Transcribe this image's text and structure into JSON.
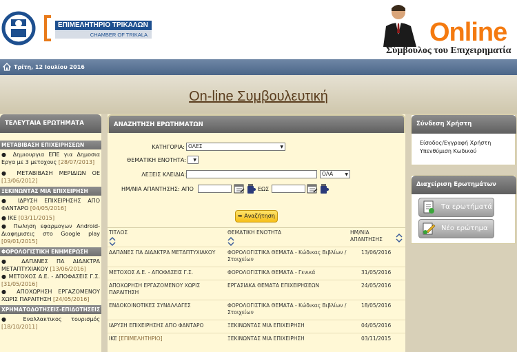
{
  "header": {
    "chamber_gr": "ΕΠΙΜΕΛΗΤΗΡΙΟ ΤΡΙΚΑΛΩΝ",
    "chamber_en": "CHAMBER OF TRIKALA",
    "online": "Online",
    "online_sub": "Σύμβουλος του Επιχειρηματία",
    "accent": "#f47a10"
  },
  "datebar": {
    "date": "Τρίτη, 12 Ιουλίου 2016"
  },
  "banner": {
    "title": "On-line Συμβουλευτική"
  },
  "left": {
    "title": "ΤΕΛΕΥΤΑΙΑ ΕΡΩΤΗΜΑΤΑ",
    "cats": [
      {
        "name": "ΜΕΤΑΒΙΒΑΣΗ ΕΠΙΧΕΙΡΗΣΕΩΝ",
        "items": [
          {
            "text": "Δημιουργια ΕΠΕ για Δημοσια Εργα με 3 μετοχους",
            "date": "[28/07/2013]"
          },
          {
            "text": "ΜΕΤΑΒΙΒΑΣΗ ΜΕΡΙΔΙΩΝ ΟΕ",
            "date": "[13/06/2012]"
          }
        ]
      },
      {
        "name": "ΞΕΚΙΝΩΝΤΑΣ ΜΙΑ ΕΠΙΧΕΙΡΗΣΗ",
        "items": [
          {
            "text": "ΙΔΡΥΣΗ ΕΠΙΧΕΙΡΗΣΗΣ ΑΠΟ ΦΑΝΤΑΡΟ",
            "date": "[04/05/2016]"
          },
          {
            "text": "ΙΚΕ",
            "date": "[03/11/2015]"
          },
          {
            "text": "Πωληση εφαρμογων Android- Διαφημισεις στο Google play",
            "date": "[09/01/2015]"
          }
        ]
      },
      {
        "name": "ΦΟΡΟΛΟΓΙΣΤΙΚΗ ΕΝΗΜΕΡΩΣΗ",
        "items": [
          {
            "text": "ΔΑΠΑΝΕΣ ΠΑ ΔΙΔΑΚΤΡΑ ΜΕΤΑΠΤΥΧΙΑΚΟΥ",
            "date": "[13/06/2016]"
          },
          {
            "text": "ΜΕΤΟΧΟΣ Α.Ε. - ΑΠΟΦΑΣΕΙΣ Γ.Σ.",
            "date": "[31/05/2016]"
          },
          {
            "text": "ΑΠΟΧΩΡΗΣΗ ΕΡΓΑΖΟΜΕΝΟΥ ΧΩΡΙΣ ΠΑΡΑΙΤΗΣΗ",
            "date": "[24/05/2016]"
          }
        ]
      },
      {
        "name": "ΧΡΗΜΑΤΟΔΟΤΗΣΕΙΣ-ΕΠΙΔΟΤΗΣΕΙΣ",
        "items": [
          {
            "text": "Εναλλακτικος τουρισμός",
            "date": "[18/10/2011]"
          }
        ]
      }
    ]
  },
  "search": {
    "title": "ΑΝΑΖΗΤΗΣΗ ΕΡΩΤΗΜΑΤΩΝ",
    "category_label": "ΚΑΤΗΓΟΡΙΑ:",
    "category_value": "ΟΛΕΣ",
    "theme_label": "ΘΕΜΑΤΙΚΗ ΕΝΟΤΗΤΑ:",
    "keywords_label": "ΛΕΞΕΙΣ ΚΛΕΙΔΙΑ:",
    "keywords_mode": "ΟΛΑ",
    "date_label": "ΗΜ/ΝΙΑ ΑΠΑΝΤΗΣΗΣ:",
    "from_label": "ΑΠΟ",
    "to_label": "ΕΩΣ",
    "button": "Αναζήτηση"
  },
  "table": {
    "headers": [
      "ΤΙΤΛΟΣ",
      "ΘΕΜΑΤΙΚΗ ΕΝΟΤΗΤΑ",
      "ΗΜ/ΝΙΑ ΑΠΑΝΤΗΣΗΣ"
    ],
    "rows": [
      {
        "title": "ΔΑΠΑΝΕΣ ΠΑ ΔΙΔΑΚΤΡΑ ΜΕΤΑΠΤΥΧΙΑΚΟΥ",
        "suffix": "",
        "theme": "ΦΟΡΟΛΟΓΙΣΤΙΚΑ ΘΕΜΑΤΑ - Κώδικας Βιβλίων / Στοιχείων",
        "date": "13/06/2016"
      },
      {
        "title": "ΜΕΤΟΧΟΣ Α.Ε. - ΑΠΟΦΑΣΕΙΣ Γ.Σ.",
        "suffix": "",
        "theme": "ΦΟΡΟΛΟΓΙΣΤΙΚΑ ΘΕΜΑΤΑ - Γενικά",
        "date": "31/05/2016"
      },
      {
        "title": "ΑΠΟΧΩΡΗΣΗ ΕΡΓΑΖΟΜΕΝΟΥ ΧΩΡΙΣ ΠΑΡΑΙΤΗΣΗ",
        "suffix": "",
        "theme": "ΕΡΓΑΣΙΑΚΑ ΘΕΜΑΤΑ ΕΠΙΧΕΙΡΗΣΕΩΝ",
        "date": "24/05/2016"
      },
      {
        "title": "ΕΝΔΟΚΟΙΝΟΤΙΚΕΣ ΣΥΝΑΛΛΑΓΕΣ",
        "suffix": "",
        "theme": "ΦΟΡΟΛΟΓΙΣΤΙΚΑ ΘΕΜΑΤΑ - Κώδικας Βιβλίων / Στοιχείων",
        "date": "18/05/2016"
      },
      {
        "title": "ΙΔΡΥΣΗ ΕΠΙΧΕΙΡΗΣΗΣ ΑΠΟ ΦΑΝΤΑΡΟ",
        "suffix": "",
        "theme": "ΞΕΚΙΝΩΝΤΑΣ ΜΙΑ ΕΠΙΧΕΙΡΗΣΗ",
        "date": "04/05/2016"
      },
      {
        "title": "ΙΚΕ",
        "suffix": "[ΕΠΙΜΕΛΗΤΗΡΙΟ]",
        "theme": "ΞΕΚΙΝΩΝΤΑΣ ΜΙΑ ΕΠΙΧΕΙΡΗΣΗ",
        "date": "03/11/2015"
      }
    ]
  },
  "login": {
    "title": "Σύνδεση Χρήστη",
    "links": [
      "Είσοδος/Εγγραφή Χρήστη",
      "Υπενθύμιση Κωδικού"
    ]
  },
  "manage": {
    "title": "Διαχείριση Ερωτημάτων",
    "btn1": "Τα ερωτήματά μου",
    "btn2": "Νέο ερώτημα"
  }
}
